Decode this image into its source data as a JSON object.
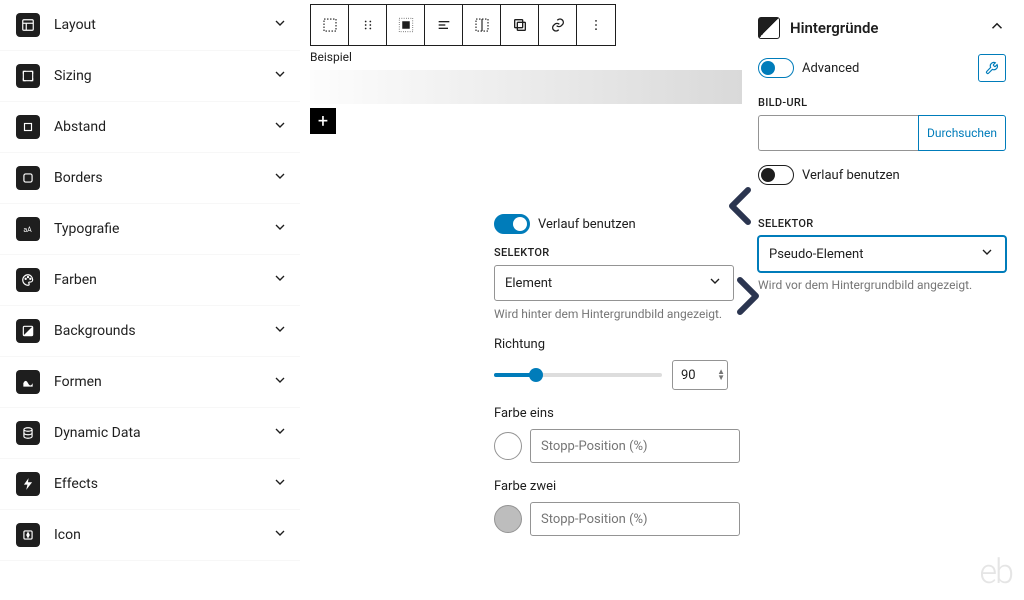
{
  "sidebar": {
    "items": [
      {
        "label": "Layout"
      },
      {
        "label": "Sizing"
      },
      {
        "label": "Abstand"
      },
      {
        "label": "Borders"
      },
      {
        "label": "Typografie"
      },
      {
        "label": "Farben"
      },
      {
        "label": "Backgrounds"
      },
      {
        "label": "Formen"
      },
      {
        "label": "Dynamic Data"
      },
      {
        "label": "Effects"
      },
      {
        "label": "Icon"
      }
    ]
  },
  "canvas": {
    "example_label": "Beispiel",
    "add_label": "+"
  },
  "mid_panel": {
    "use_gradient_label": "Verlauf benutzen",
    "selector_caption": "SELEKTOR",
    "selector_value": "Element",
    "selector_hint": "Wird hinter dem Hintergrundbild angezeigt.",
    "direction_label": "Richtung",
    "direction_value": "90",
    "color1_label": "Farbe eins",
    "color2_label": "Farbe zwei",
    "stop_placeholder": "Stopp-Position (%)"
  },
  "right_panel": {
    "title": "Hintergründe",
    "advanced_label": "Advanced",
    "url_caption": "BILD-URL",
    "browse_label": "Durchsuchen",
    "use_gradient_label": "Verlauf benutzen",
    "selector_caption": "SELEKTOR",
    "selector_value": "Pseudo-Element",
    "selector_hint": "Wird vor dem Hintergrundbild angezeigt."
  },
  "watermark": "eb"
}
